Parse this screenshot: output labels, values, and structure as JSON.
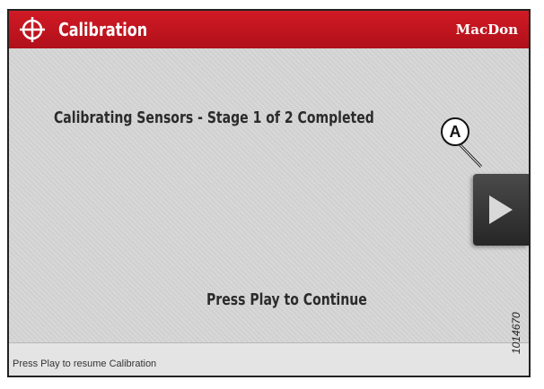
{
  "header": {
    "title": "Calibration",
    "brand": "MacDon",
    "title_icon": "crosshair-icon",
    "colors": {
      "header_bg": "#c4141f",
      "header_text": "#ffffff"
    }
  },
  "main": {
    "stage_message": "Calibrating Sensors - Stage 1 of 2 Completed",
    "continue_message": "Press Play to Continue",
    "play_button": {
      "icon": "play-icon"
    }
  },
  "status_bar": {
    "text": "Press Play to resume Calibration"
  },
  "annotations": {
    "callout_label": "A",
    "figure_id": "1014670"
  }
}
